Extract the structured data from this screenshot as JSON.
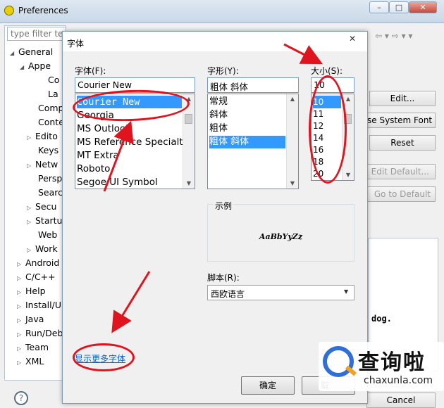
{
  "window": {
    "title": "Preferences",
    "controls": [
      "–",
      "□",
      "✕"
    ]
  },
  "sidebar": {
    "filter_placeholder": "type filter te",
    "tree": [
      {
        "label": "General",
        "arrow": "◢"
      },
      {
        "label": "Appe",
        "arrow": "◢"
      },
      {
        "label": "Co",
        "arrow": ""
      },
      {
        "label": "La",
        "arrow": ""
      },
      {
        "label": "Comp",
        "arrow": ""
      },
      {
        "label": "Conte",
        "arrow": ""
      },
      {
        "label": "Edito",
        "arrow": "▷"
      },
      {
        "label": "Keys",
        "arrow": ""
      },
      {
        "label": "Netw",
        "arrow": "▷"
      },
      {
        "label": "Persp",
        "arrow": ""
      },
      {
        "label": "Searc",
        "arrow": ""
      },
      {
        "label": "Secu",
        "arrow": "▷"
      },
      {
        "label": "Startu",
        "arrow": "▷"
      },
      {
        "label": "Web",
        "arrow": ""
      },
      {
        "label": "Work",
        "arrow": "▷"
      },
      {
        "label": "Android",
        "arrow": "▷"
      },
      {
        "label": "C/C++",
        "arrow": "▷"
      },
      {
        "label": "Help",
        "arrow": "▷"
      },
      {
        "label": "Install/Up",
        "arrow": "▷"
      },
      {
        "label": "Java",
        "arrow": "▷"
      },
      {
        "label": "Run/Deb",
        "arrow": "▷"
      },
      {
        "label": "Team",
        "arrow": "▷"
      },
      {
        "label": "XML",
        "arrow": "▷"
      }
    ],
    "help_icon": "?"
  },
  "pref_panel": {
    "buttons": {
      "edit": "Edit...",
      "use_system_font": "se System Font",
      "reset": "Reset",
      "edit_default": "Edit Default...",
      "go_to_default": "Go to Default",
      "cancel": "Cancel"
    },
    "preview_text": "dog."
  },
  "font_dialog": {
    "title": "字体",
    "close": "✕",
    "font_label": "字体(F):",
    "font_value": "Courier New",
    "font_list": [
      "Courier New",
      "Georgia",
      "MS Outlook",
      "MS Reference Specialt",
      "MT Extra",
      "Roboto",
      "Segoe UI Symbol"
    ],
    "font_selected_index": 0,
    "style_label": "字形(Y):",
    "style_value": "粗体 斜体",
    "style_list": [
      "常规",
      "斜体",
      "粗体",
      "粗体 斜体"
    ],
    "style_selected_index": 3,
    "size_label": "大小(S):",
    "size_value": "10",
    "size_list": [
      "10",
      "11",
      "12",
      "14",
      "16",
      "18",
      "20"
    ],
    "size_selected_index": 0,
    "sample_label": "示例",
    "sample_text": "AaBbYyZz",
    "script_label": "脚本(R):",
    "script_value": "西欧语言",
    "more_fonts_link": "显示更多字体",
    "ok_button": "确定",
    "cancel_button": "取"
  },
  "watermark": {
    "cn": "查询啦",
    "en": "chaxunla.com"
  },
  "colors": {
    "selection": "#3399ff",
    "annotation_red": "#e0141f",
    "link": "#0066cc"
  }
}
